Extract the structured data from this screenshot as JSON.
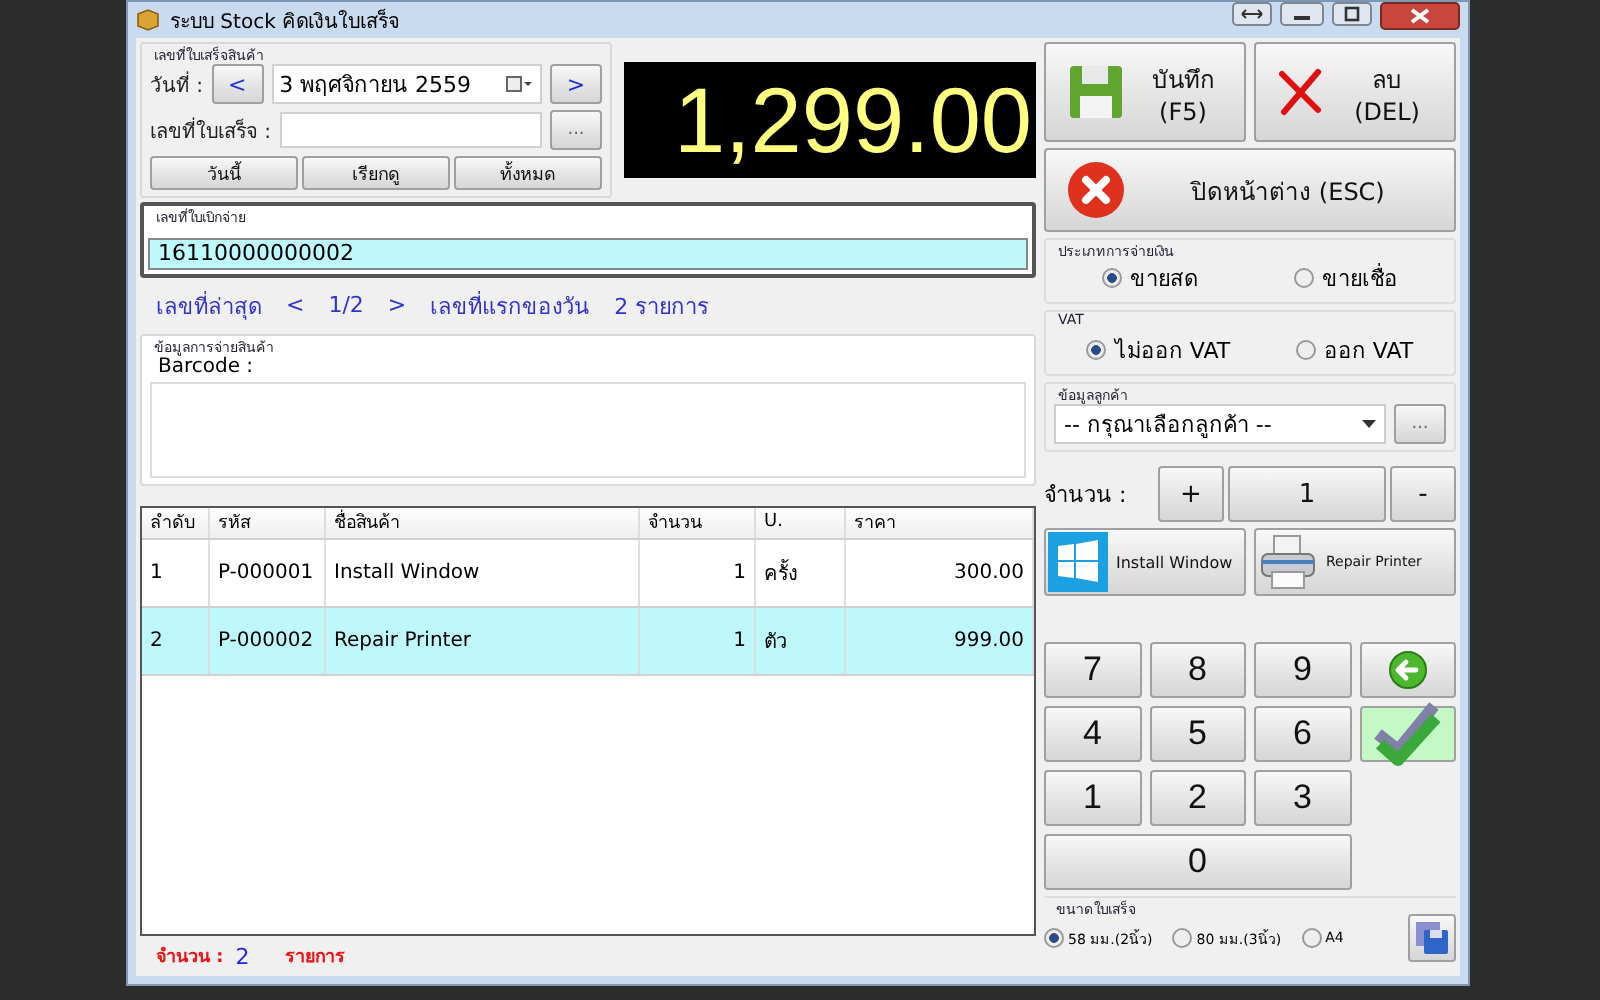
{
  "window": {
    "title": "ระบบ Stock คิดเงินใบเสร็จ"
  },
  "receipt_group": {
    "label": "เลขที่ใบเสร็จสินค้า",
    "date_label": "วันที่ :",
    "prev": "<",
    "date": "3 พฤศจิกายน  2559",
    "next": ">",
    "number_label": "เลขที่ใบเสร็จ :",
    "browse": "...",
    "buttons": [
      "วันนี้",
      "เรียกดู",
      "ทั้งหมด"
    ]
  },
  "total": "1,299.00",
  "withdraw_group": {
    "label": "เลขที่ใบเบิกจ่าย",
    "value": "16110000000002"
  },
  "navigation": {
    "latest": "เลขที่ล่าสุด",
    "prev": "<",
    "page": "1/2",
    "next": ">",
    "first": "เลขที่แรกของวัน",
    "count": "2 รายการ"
  },
  "payment_info": {
    "label": "ข้อมูลการจ่ายสินค้า",
    "barcode_label": "Barcode :"
  },
  "table": {
    "columns": [
      "ลำดับ",
      "รหัส",
      "ชื่อสินค้า",
      "จำนวน",
      "U.",
      "ราคา"
    ],
    "rows": [
      {
        "cells": [
          "1",
          "P-000001",
          "Install Window",
          "1",
          "ครั้ง",
          "300.00"
        ],
        "selected": false
      },
      {
        "cells": [
          "2",
          "P-000002",
          "Repair Printer",
          "1",
          "ตัว",
          "999.00"
        ],
        "selected": true
      }
    ]
  },
  "footer": {
    "label": "จำนวน :",
    "count": "2",
    "unit": "รายการ"
  },
  "actions": {
    "save": [
      "บันทึก",
      "(F5)"
    ],
    "delete": [
      "ลบ",
      "(DEL)"
    ],
    "close": "ปิดหน้าต่าง (ESC)"
  },
  "payment_type": {
    "label": "ประเภทการจ่ายเงิน",
    "options": [
      {
        "label": "ขายสด",
        "selected": true
      },
      {
        "label": "ขายเชื่อ",
        "selected": false
      }
    ]
  },
  "vat": {
    "label": "VAT",
    "options": [
      {
        "label": "ไม่ออก VAT",
        "selected": true
      },
      {
        "label": "ออก VAT",
        "selected": false
      }
    ]
  },
  "customer": {
    "label": "ข้อมูลลูกค้า",
    "value": "-- กรุณาเลือกลูกค้า --",
    "browse": "..."
  },
  "quantity": {
    "label": "จำนวน :",
    "plus": "+",
    "value": "1",
    "minus": "-"
  },
  "products": [
    {
      "kind": "windows",
      "label": "Install Window"
    },
    {
      "kind": "printer",
      "label": "Repair Printer"
    }
  ],
  "keypad": [
    {
      "kind": "digit",
      "label": "7"
    },
    {
      "kind": "digit",
      "label": "8"
    },
    {
      "kind": "digit",
      "label": "9"
    },
    {
      "kind": "back"
    },
    {
      "kind": "digit",
      "label": "4"
    },
    {
      "kind": "digit",
      "label": "5"
    },
    {
      "kind": "digit",
      "label": "6"
    },
    {
      "kind": "enter"
    },
    {
      "kind": "digit",
      "label": "1"
    },
    {
      "kind": "digit",
      "label": "2"
    },
    {
      "kind": "digit",
      "label": "3"
    },
    {
      "kind": "wide",
      "label": "0"
    }
  ],
  "receipt_size": {
    "label": "ขนาดใบเสร็จ",
    "options": [
      {
        "label": "58 มม.(2นิ้ว)",
        "selected": true
      },
      {
        "label": "80 มม.(3นิ้ว)",
        "selected": false
      },
      {
        "label": "A4",
        "selected": false
      }
    ]
  }
}
